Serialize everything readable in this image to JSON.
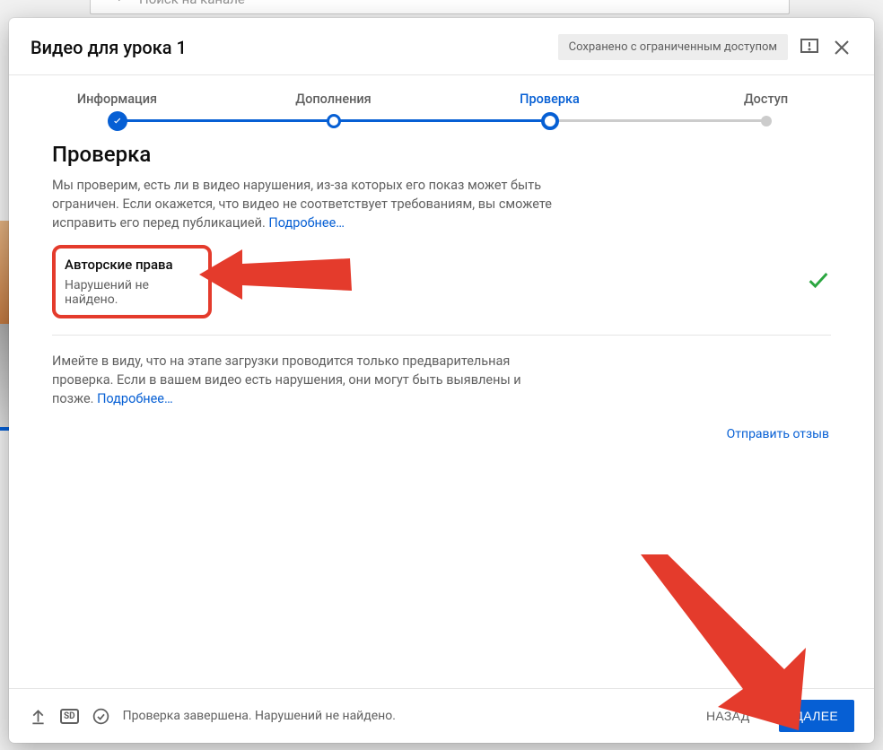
{
  "search": {
    "placeholder": "Поиск на канале"
  },
  "dialog": {
    "title": "Видео для урока 1",
    "saved_chip": "Сохранено с ограниченным доступом"
  },
  "stepper": {
    "info": "Информация",
    "additions": "Дополнения",
    "checks": "Проверка",
    "access": "Доступ"
  },
  "section": {
    "title": "Проверка",
    "desc": "Мы проверим, есть ли в видео нарушения, из-за которых его показ может быть ограничен. Если окажется, что видео не соответствует требованиям, вы сможете исправить его перед публикацией. ",
    "desc_more": "Подробнее…"
  },
  "copyright": {
    "title": "Авторские права",
    "status": "Нарушений не найдено."
  },
  "note": {
    "text": "Имейте в виду, что на этапе загрузки проводится только предварительная проверка. Если в вашем видео есть нарушения, они могут быть выявлены и позже. ",
    "more": "Подробнее…"
  },
  "feedback": "Отправить отзыв",
  "footer": {
    "sd": "SD",
    "status": "Проверка завершена. Нарушений не найдено.",
    "back": "НАЗАД",
    "next": "ДАЛЕЕ"
  }
}
